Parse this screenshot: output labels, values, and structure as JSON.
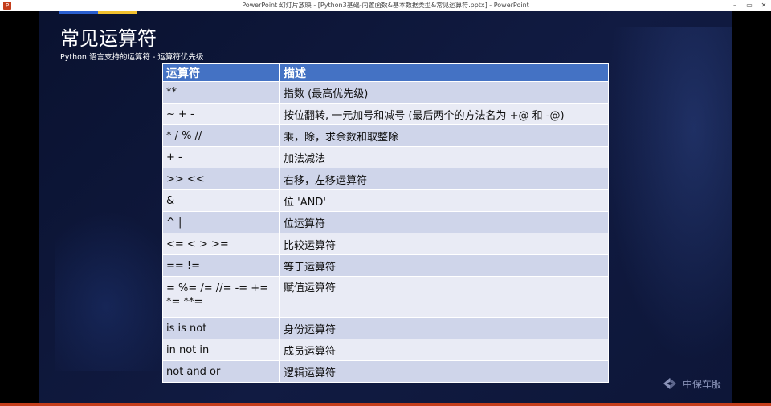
{
  "window": {
    "title": "PowerPoint 幻灯片放映 - [Python3基础-内置函数&基本数据类型&常见运算符.pptx] - PowerPoint",
    "app_icon": "P",
    "buttons": [
      "–",
      "▭",
      "✕"
    ]
  },
  "slide": {
    "title": "常见运算符",
    "subtitle": "Python 语言支持的运算符 - 运算符优先级",
    "table": {
      "headers": [
        "运算符",
        "描述"
      ],
      "rows": [
        [
          "**",
          "指数 (最高优先级)"
        ],
        [
          "~ + -",
          "按位翻转, 一元加号和减号 (最后两个的方法名为 +@ 和 -@)"
        ],
        [
          "* / % //",
          "乘，除，求余数和取整除"
        ],
        [
          "+ -",
          "加法减法"
        ],
        [
          ">> <<",
          "右移，左移运算符"
        ],
        [
          "&",
          "位 'AND'"
        ],
        [
          "^ |",
          "位运算符"
        ],
        [
          "<= < > >=",
          "比较运算符"
        ],
        [
          "== !=",
          "等于运算符"
        ],
        [
          "= %= /= //= -= += *= **=",
          "赋值运算符"
        ],
        [
          "is is not",
          "身份运算符"
        ],
        [
          "in not in",
          "成员运算符"
        ],
        [
          "not and or",
          "逻辑运算符"
        ]
      ]
    },
    "logo_text": "中保车服"
  },
  "colors": {
    "accent_blue": "#2a5fd0",
    "accent_yellow": "#f2c12e",
    "table_header": "#4472c4",
    "row_dark": "#cfd5ea",
    "row_light": "#e9ebf5"
  }
}
